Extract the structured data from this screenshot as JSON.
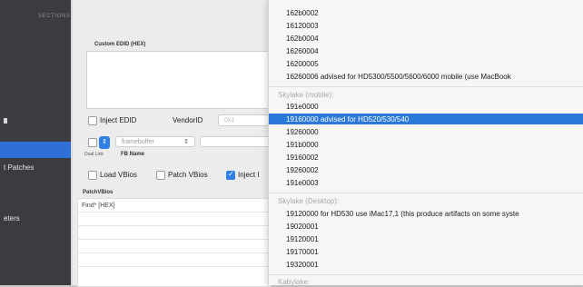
{
  "sidebar": {
    "header": "SECTIONS",
    "items": [
      "t Patches",
      "eters"
    ],
    "selected_index": 0
  },
  "main": {
    "custom_edid_label": "Custom EDID (HEX)",
    "inject_edid_label": "Inject EDID",
    "vendor_id_label": "VendorID",
    "vendor_id_placeholder": "0x1",
    "dual_link_label": "Dual Link",
    "fb_name_label": "FB Name",
    "framebuffer_placeholder": "framebuffer",
    "load_vbios_label": "Load VBios",
    "patch_vbios_label": "Patch VBios",
    "inject_label": "Inject I",
    "patch_vbios_header": "PatchVBios",
    "find_column": "Find* [HEX]"
  },
  "menu": {
    "top_items": [
      "162b0002",
      "16120003",
      "162b0004",
      "16260004",
      "16200005",
      "16260006 advised for HD5300/5500/5600/6000 mobile (use MacBook"
    ],
    "skylake_mobile_header": "Skylake (mobile):",
    "skylake_mobile_items": [
      "191e0000",
      "19160000 advised for HD520/530/540",
      "19260000",
      "191b0000",
      "19160002",
      "19260002",
      "191e0003"
    ],
    "selected_index": 1,
    "skylake_desktop_header": "Skylake (Desktop):",
    "skylake_desktop_items": [
      "19120000 for HD530 use iMac17,1 (this produce artifacts on some syste",
      "19020001",
      "19120001",
      "19170001",
      "19320001"
    ],
    "next_header": "Kabylake:"
  },
  "colors": {
    "accent": "#2a78d9",
    "sidebar": "#3a3c40"
  }
}
